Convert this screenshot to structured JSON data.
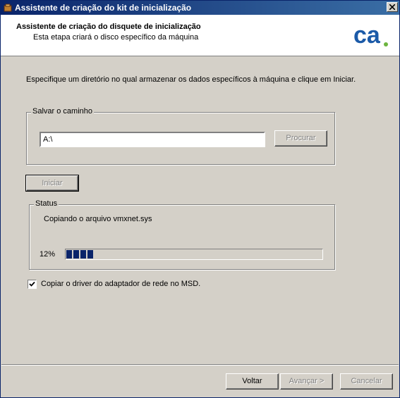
{
  "window": {
    "title": "Assistente de criação do kit de inicialização",
    "close_label": "X"
  },
  "header": {
    "title": "Assistente de criação do disquete de inicialização",
    "subtitle": "Esta etapa criará o disco específico da máquina",
    "logo_text": "ca"
  },
  "instruction": "Especifique um diretório no qual armazenar os dados específicos à máquina e clique em Iniciar.",
  "save_path": {
    "group_label": "Salvar o caminho",
    "value": "A:\\",
    "browse_label": "Procurar"
  },
  "start_label": "Iniciar",
  "status": {
    "group_label": "Status",
    "text": "Copiando o arquivo vmxnet.sys",
    "percent_label": "12%",
    "progress": 0.12
  },
  "checkbox": {
    "label": "Copiar o driver do adaptador de rede no MSD.",
    "checked": true
  },
  "footer": {
    "back_label": "Voltar",
    "next_label": "Avançar >",
    "cancel_label": "Cancelar"
  },
  "colors": {
    "title_bar": "#0a246a",
    "progress": "#0a246a",
    "logo_blue": "#1b5aa8",
    "logo_green": "#6cb43f"
  }
}
